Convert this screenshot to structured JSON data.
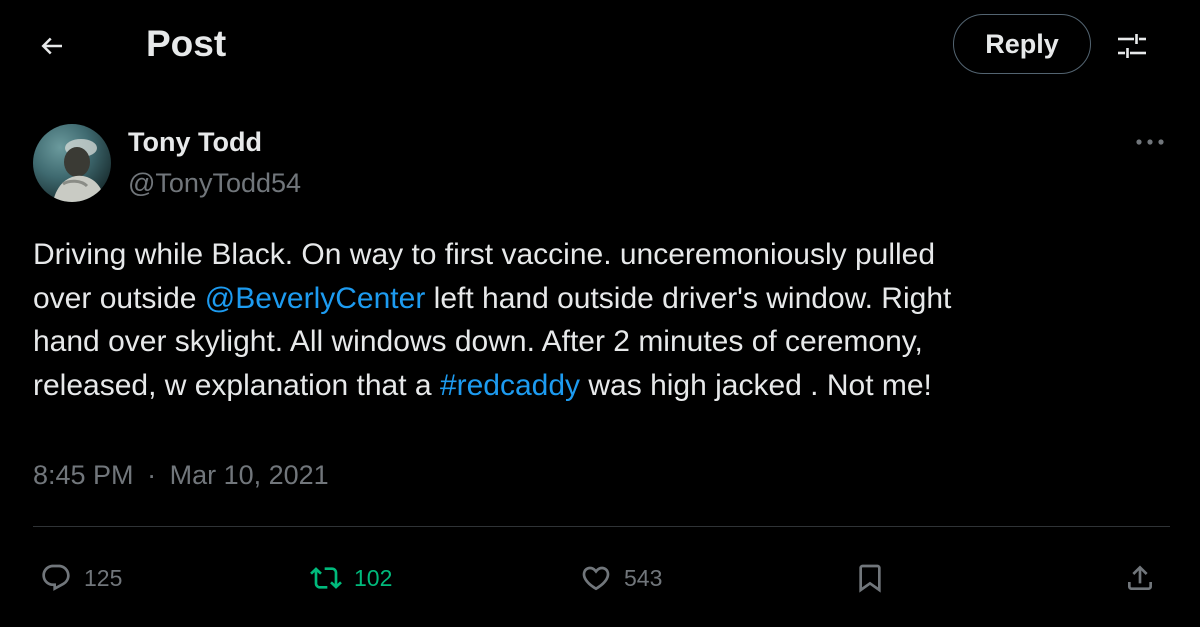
{
  "header": {
    "back_icon": "arrow-left-icon",
    "title": "Post",
    "reply_label": "Reply",
    "filter_icon": "sliders-icon"
  },
  "tweet": {
    "author": {
      "display_name": "Tony Todd",
      "handle": "@TonyTodd54"
    },
    "more_icon": "more-horizontal-icon",
    "text": {
      "seg1": "Driving while Black. On way to  first vaccine.  unceremoniously pulled\nover outside ",
      "mention": "@BeverlyCenter",
      "seg2": " left hand outside  driver's window. Right\nhand  over skylight. All windows  down. After 2 minutes of ceremony,\nreleased,  w explanation that a ",
      "hashtag": "#redcaddy",
      "seg3": " was high jacked . Not me!"
    },
    "time": "8:45 PM",
    "separator": "·",
    "date": "Mar 10, 2021"
  },
  "actions": {
    "replies": "125",
    "retweets": "102",
    "likes": "543"
  },
  "colors": {
    "background": "#000000",
    "text_primary": "#e7e9ea",
    "text_secondary": "#71767b",
    "link": "#1d9bf0",
    "retweet_active": "#00ba7c",
    "divider": "#2f3336"
  }
}
